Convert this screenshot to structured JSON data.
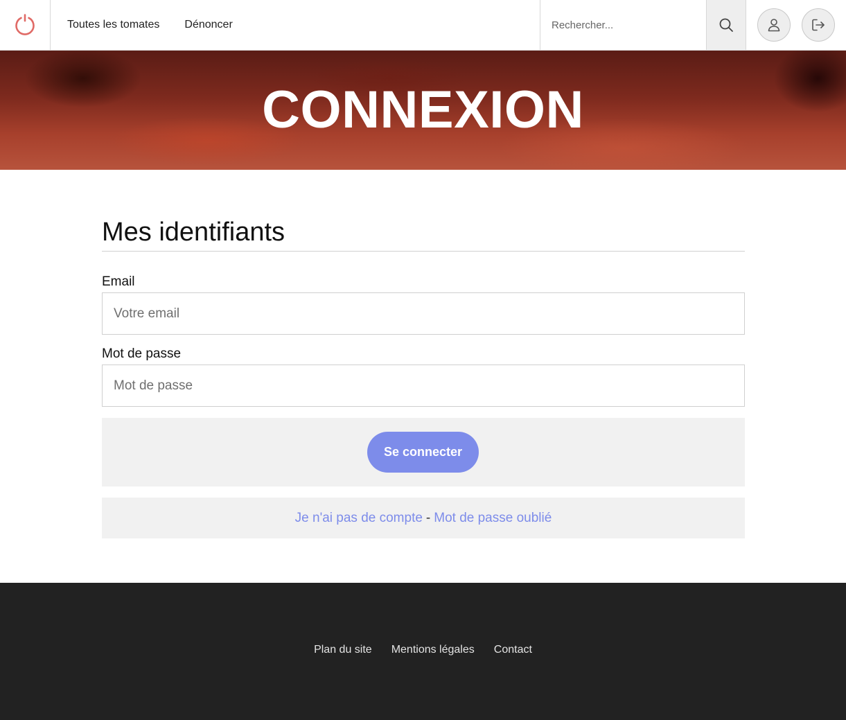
{
  "header": {
    "nav": [
      {
        "label": "Toutes les tomates"
      },
      {
        "label": "Dénoncer"
      }
    ],
    "search": {
      "placeholder": "Rechercher..."
    },
    "logo_icon": "power-icon",
    "search_icon": "search-icon",
    "user_icon": "user-icon",
    "logout_icon": "logout-icon",
    "logo_color": "#e06a66"
  },
  "hero": {
    "title": "CONNEXION"
  },
  "form": {
    "title": "Mes identifiants",
    "email": {
      "label": "Email",
      "placeholder": "Votre email"
    },
    "password": {
      "label": "Mot de passe",
      "placeholder": "Mot de passe"
    },
    "submit_label": "Se connecter",
    "links": {
      "no_account": "Je n'ai pas de compte",
      "separator": "-",
      "forgot": "Mot de passe oublié"
    }
  },
  "footer": {
    "links": [
      {
        "label": "Plan du site"
      },
      {
        "label": "Mentions légales"
      },
      {
        "label": "Contact"
      }
    ]
  },
  "colors": {
    "accent": "#7d8cea",
    "footer_bg": "#222222",
    "panel_bg": "#f1f1f1"
  }
}
